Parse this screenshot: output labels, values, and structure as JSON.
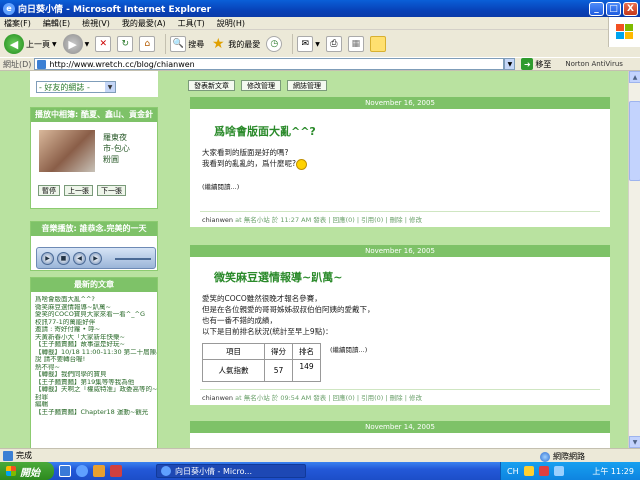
{
  "window": {
    "title": "向日葵小倩 - Microsoft Internet Explorer",
    "controls": [
      "_",
      "□",
      "X"
    ]
  },
  "menu": [
    "檔案(F)",
    "編輯(E)",
    "檢視(V)",
    "我的最愛(A)",
    "工具(T)",
    "說明(H)"
  ],
  "toolbar": {
    "back_label": "上一頁",
    "search_label": "搜尋",
    "favorites_label": "我的最愛"
  },
  "address": {
    "label": "網址(D)",
    "url": "http://www.wretch.cc/blog/chianwen",
    "go_label": "移至",
    "norton": "Norton AntiVirus"
  },
  "sidebar": {
    "friends_select": "- 好友的網誌 -",
    "now_playing_head": "播放中相簿: 酷夏、鑫山、貢金針",
    "profile_lines": [
      "羅東夜",
      "市-包心",
      "粉圓"
    ],
    "album_buttons": [
      "暫停",
      "上一張",
      "下一張"
    ],
    "music_head": "音樂播放: 誰恭念.完美的一天",
    "latest_head": "最新的文章",
    "latest_items": [
      "爲啥會版面大亂^^?",
      "微笑麻豆選情報導~趴萬~",
      "愛笑的COCO寶貝大家來看一看^_^G",
      "校訊77-1的萬能好伴",
      "邀請     :     寄好付蘿 • 呼~",
      "天黃新春小大「大家新年快樂~",
      "【王子麵賣麵】故事還是好玩~",
      "【轉載】10/18 11:00-11:30 第二十屆陳暑",
      "說 請不要轉台喔!",
      "熱不得~",
      "【轉載】我們同學的寶貝",
      "【王子麵賣麵】第19集等等我為他",
      "【轉載】天啊之「權威特准」政委高等的~",
      "封罪",
      "編輯",
      "【王子麵賣麵】Chapter18 運動~觀光"
    ]
  },
  "main": {
    "tabs": [
      "發表新文章",
      "修改管理",
      "網誌管理"
    ],
    "posts": [
      {
        "date": "November 16, 2005",
        "title": "爲啥會版面大亂^^?",
        "lines": [
          "大家看到的版面是好的嗎?",
          "我看到的亂亂的，爲什麼呢?"
        ],
        "more": "(繼續閱讀...)",
        "footer_author": "chianwen",
        "footer_rest": " at 無名小站 於 11:27 AM 發表 | 回應(0) | 引用(0) | 刪除 | 修改"
      },
      {
        "date": "November 16, 2005",
        "title": "微笑麻豆選情報導~趴萬~",
        "lines": [
          "愛笑的COCO雖然很晚才報名參賽，",
          "但是在各位親愛的哥哥姊姊叔叔伯伯阿姨的愛戴下，",
          "也有一番不錯的成績，",
          "以下是目前排名狀況(統計至早上9點)："
        ],
        "table_head": [
          "項目",
          "得分",
          "排名"
        ],
        "table_row": [
          "人氣指數",
          "57",
          "149"
        ],
        "more": "(繼續閱讀...)",
        "footer_author": "chianwen",
        "footer_rest": " at 無名小站 於 09:54 AM 發表 | 回應(0) | 引用(0) | 刪除 | 修改"
      },
      {
        "date": "November 14, 2005"
      }
    ]
  },
  "status": {
    "text": "完成",
    "zone": "網際網路"
  },
  "taskbar": {
    "start": "開始",
    "task": "向日葵小倩 - Micro...",
    "lang": "CH",
    "clock": "上午 11:29"
  }
}
